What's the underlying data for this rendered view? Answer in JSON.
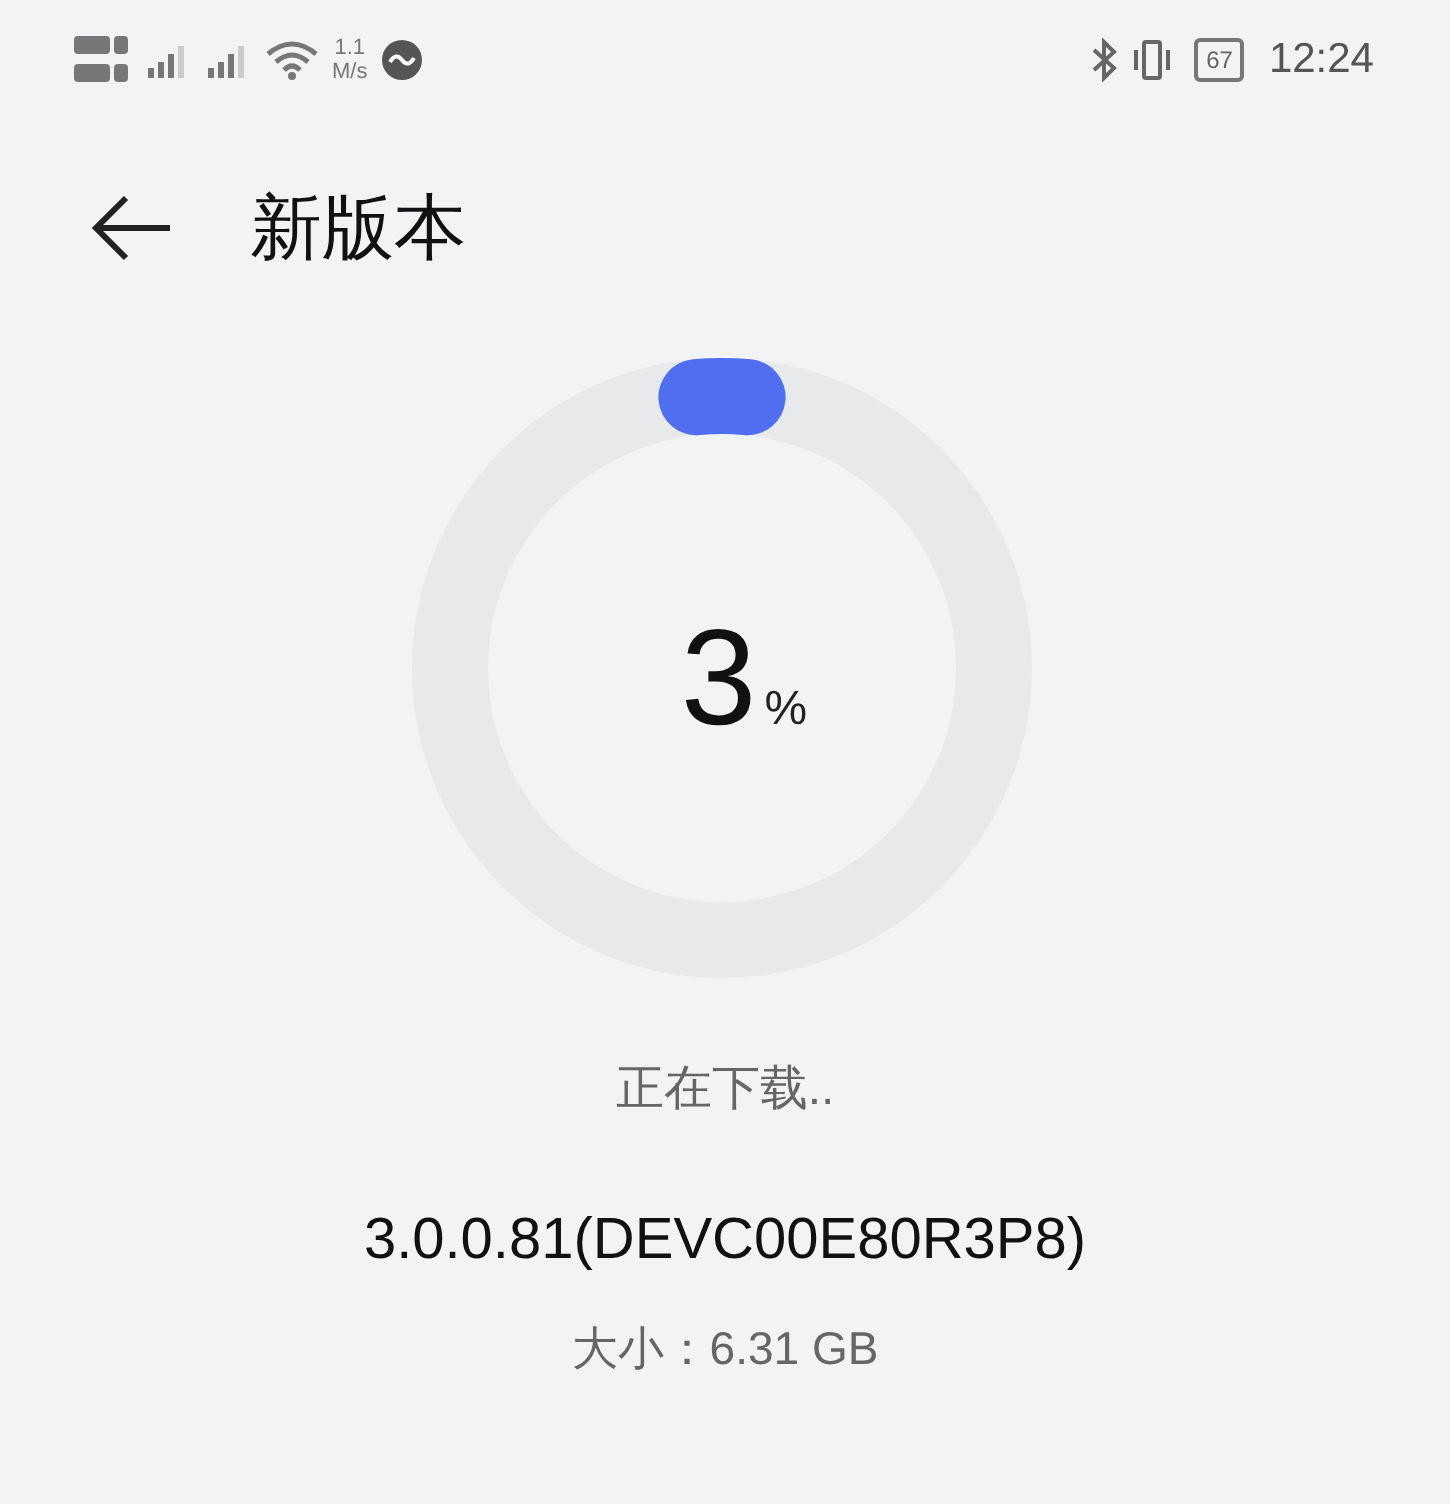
{
  "status_bar": {
    "speed": "1.1",
    "speed_unit": "M/s",
    "battery": "67",
    "time": "12:24"
  },
  "header": {
    "title": "新版本"
  },
  "progress": {
    "percent": "3",
    "unit": "%"
  },
  "status_text": "正在下载..",
  "version": "3.0.0.81(DEVC00E80R3P8)",
  "size": "大小：6.31 GB"
}
